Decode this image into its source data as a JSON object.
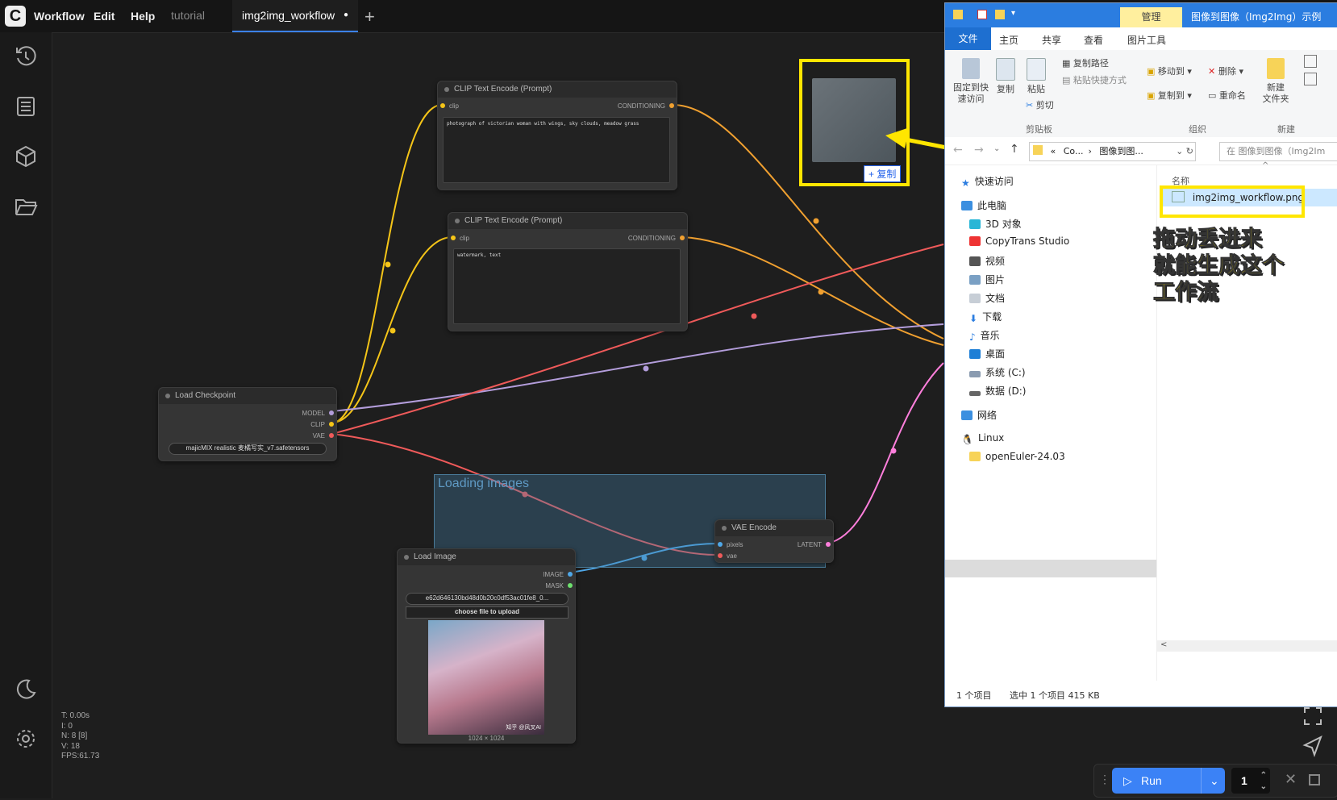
{
  "app": {
    "menu": [
      "Workflow",
      "Edit",
      "Help"
    ],
    "tabs": [
      {
        "label": "tutorial"
      },
      {
        "label": "img2img_workflow",
        "modified_mark": "●"
      }
    ]
  },
  "nodes": {
    "clip1": {
      "title": "CLIP Text Encode (Prompt)",
      "input": "clip",
      "output": "CONDITIONING",
      "text": "photograph of victorian woman with wings, sky clouds, meadow grass"
    },
    "clip2": {
      "title": "CLIP Text Encode (Prompt)",
      "input": "clip",
      "output": "CONDITIONING",
      "text": "watermark, text"
    },
    "checkpoint": {
      "title": "Load Checkpoint",
      "outputs": [
        "MODEL",
        "CLIP",
        "VAE"
      ],
      "model": "majicMIX realistic 麦橘写实_v7.safetensors"
    },
    "vae_encode": {
      "title": "VAE Encode",
      "inputs": [
        "pixels",
        "vae"
      ],
      "output": "LATENT"
    },
    "load_image": {
      "title": "Load Image",
      "outputs": [
        "IMAGE",
        "MASK"
      ],
      "file": "e62d646130bd48d0b20c0df53ac01fe8_0...",
      "upload_label": "choose file to upload",
      "size": "1024 × 1024",
      "watermark": "知乎 @风叉AI"
    },
    "group_title": "Loading images"
  },
  "stats": [
    "T: 0.00s",
    "I: 0",
    "N: 8 [8]",
    "V: 18",
    "FPS:61.73"
  ],
  "drag": {
    "copy_label": "+ 复制"
  },
  "explorer": {
    "manage_tab": "管理",
    "title": "图像到图像（Img2Img）示例",
    "ribbon_tabs": [
      "文件",
      "主页",
      "共享",
      "查看",
      "图片工具"
    ],
    "ribbon": {
      "pin": "固定到快\n速访问",
      "copy": "复制",
      "paste": "粘贴",
      "copy_path": "复制路径",
      "paste_shortcut": "粘贴快捷方式",
      "cut": "剪切",
      "move_to": "移动到",
      "copy_to": "复制到",
      "delete": "删除",
      "rename": "重命名",
      "new_folder": "新建\n文件夹",
      "group_clipboard": "剪贴板",
      "group_organize": "组织",
      "group_new": "新建"
    },
    "address": {
      "part1": "Co...",
      "part2": "图像到图...",
      "prefix": "«"
    },
    "search_placeholder": "在 图像到图像（Img2Im",
    "column_name": "名称",
    "nav": [
      "快速访问",
      "此电脑",
      "3D 对象",
      "CopyTrans Studio",
      "视频",
      "图片",
      "文档",
      "下载",
      "音乐",
      "桌面",
      "系统 (C:)",
      "数据 (D:)",
      "网络",
      "Linux",
      "openEuler-24.03"
    ],
    "file": "img2img_workflow.png",
    "status": {
      "count": "1 个项目",
      "selected": "选中 1 个项目  415 KB"
    }
  },
  "annotation": [
    "拖动丢进来",
    "就能生成这个",
    "工作流"
  ],
  "run": {
    "label": "Run",
    "count": "1"
  },
  "colors": {
    "accent": "#3b82f6",
    "highlight": "#ffe600",
    "clip_wire": "#f5c518",
    "cond_wire": "#f0a030",
    "vae_wire": "#ef5a5a",
    "model_wire": "#b39ddb",
    "latent_wire": "#ff7fdc",
    "image_wire": "#4fa8e8"
  }
}
